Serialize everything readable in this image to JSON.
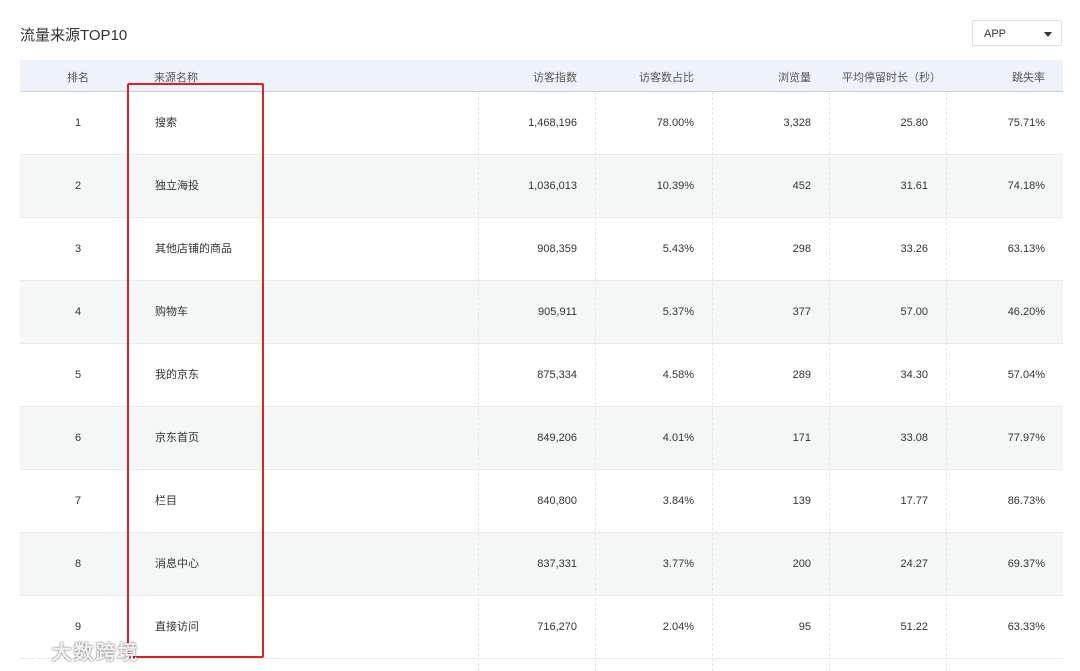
{
  "panel": {
    "title": "流量来源TOP10",
    "platform_select": "APP"
  },
  "table": {
    "columns": [
      "排名",
      "来源名称",
      "访客指数",
      "访客数占比",
      "浏览量",
      "平均停留时长（秒）",
      "跳失率"
    ],
    "rows": [
      [
        "1",
        "搜索",
        "1,468,196",
        "78.00%",
        "3,328",
        "25.80",
        "75.71%"
      ],
      [
        "2",
        "独立海投",
        "1,036,013",
        "10.39%",
        "452",
        "31.61",
        "74.18%"
      ],
      [
        "3",
        "其他店铺的商品",
        "908,359",
        "5.43%",
        "298",
        "33.26",
        "63.13%"
      ],
      [
        "4",
        "购物车",
        "905,911",
        "5.37%",
        "377",
        "57.00",
        "46.20%"
      ],
      [
        "5",
        "我的京东",
        "875,334",
        "4.58%",
        "289",
        "34.30",
        "57.04%"
      ],
      [
        "6",
        "京东首页",
        "849,206",
        "4.01%",
        "171",
        "33.08",
        "77.97%"
      ],
      [
        "7",
        "栏目",
        "840,800",
        "3.84%",
        "139",
        "17.77",
        "86.73%"
      ],
      [
        "8",
        "消息中心",
        "837,331",
        "3.77%",
        "200",
        "24.27",
        "69.37%"
      ],
      [
        "9",
        "直接访问",
        "716,270",
        "2.04%",
        "95",
        "51.22",
        "63.33%"
      ]
    ]
  },
  "annotation": {
    "highlight_color": "#e02020"
  },
  "watermark": {
    "text": "大数跨境"
  }
}
